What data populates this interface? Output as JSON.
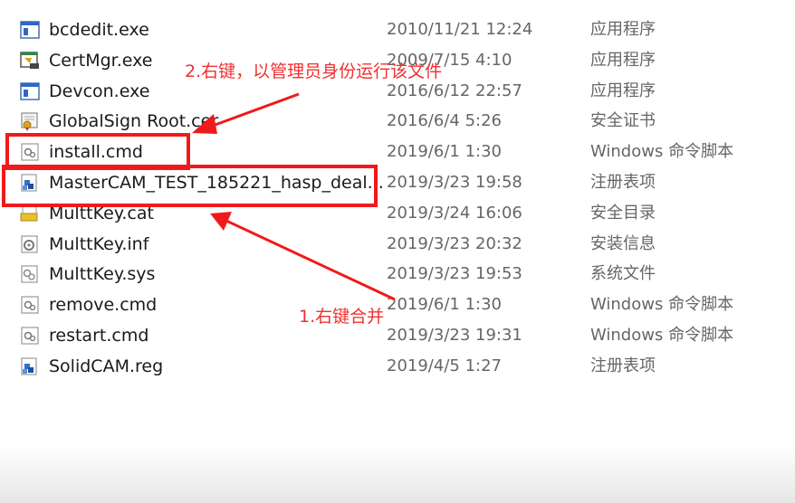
{
  "files": [
    {
      "name": "bcdedit.exe",
      "date": "2010/11/21 12:24",
      "type": "应用程序",
      "icon": "exe-window-icon"
    },
    {
      "name": "CertMgr.exe",
      "date": "2009/7/15 4:10",
      "type": "应用程序",
      "icon": "certmgr-app-icon"
    },
    {
      "name": "Devcon.exe",
      "date": "2016/6/12 22:57",
      "type": "应用程序",
      "icon": "exe-window-icon"
    },
    {
      "name": "GlobalSign Root.cer",
      "date": "2016/6/4 5:26",
      "type": "安全证书",
      "icon": "certificate-icon"
    },
    {
      "name": "install.cmd",
      "date": "2019/6/1 1:30",
      "type": "Windows 命令脚本",
      "icon": "cmd-script-icon"
    },
    {
      "name": "MasterCAM_TEST_185221_hasp_deal...",
      "date": "2019/3/23 19:58",
      "type": "注册表项",
      "icon": "registry-icon"
    },
    {
      "name": "MulttKey.cat",
      "date": "2019/3/24 16:06",
      "type": "安全目录",
      "icon": "security-catalog-icon"
    },
    {
      "name": "MulttKey.inf",
      "date": "2019/3/23 20:32",
      "type": "安装信息",
      "icon": "setup-info-icon"
    },
    {
      "name": "MulttKey.sys",
      "date": "2019/3/23 19:53",
      "type": "系统文件",
      "icon": "system-file-icon"
    },
    {
      "name": "remove.cmd",
      "date": "2019/6/1 1:30",
      "type": "Windows 命令脚本",
      "icon": "cmd-script-icon"
    },
    {
      "name": "restart.cmd",
      "date": "2019/3/23 19:31",
      "type": "Windows 命令脚本",
      "icon": "cmd-script-icon"
    },
    {
      "name": "SolidCAM.reg",
      "date": "2019/4/5 1:27",
      "type": "注册表项",
      "icon": "registry-icon"
    }
  ],
  "annotations": {
    "step1": "1.右键合并",
    "step2": "2.右键，以管理员身份运行该文件",
    "color": "#f01a1a"
  }
}
